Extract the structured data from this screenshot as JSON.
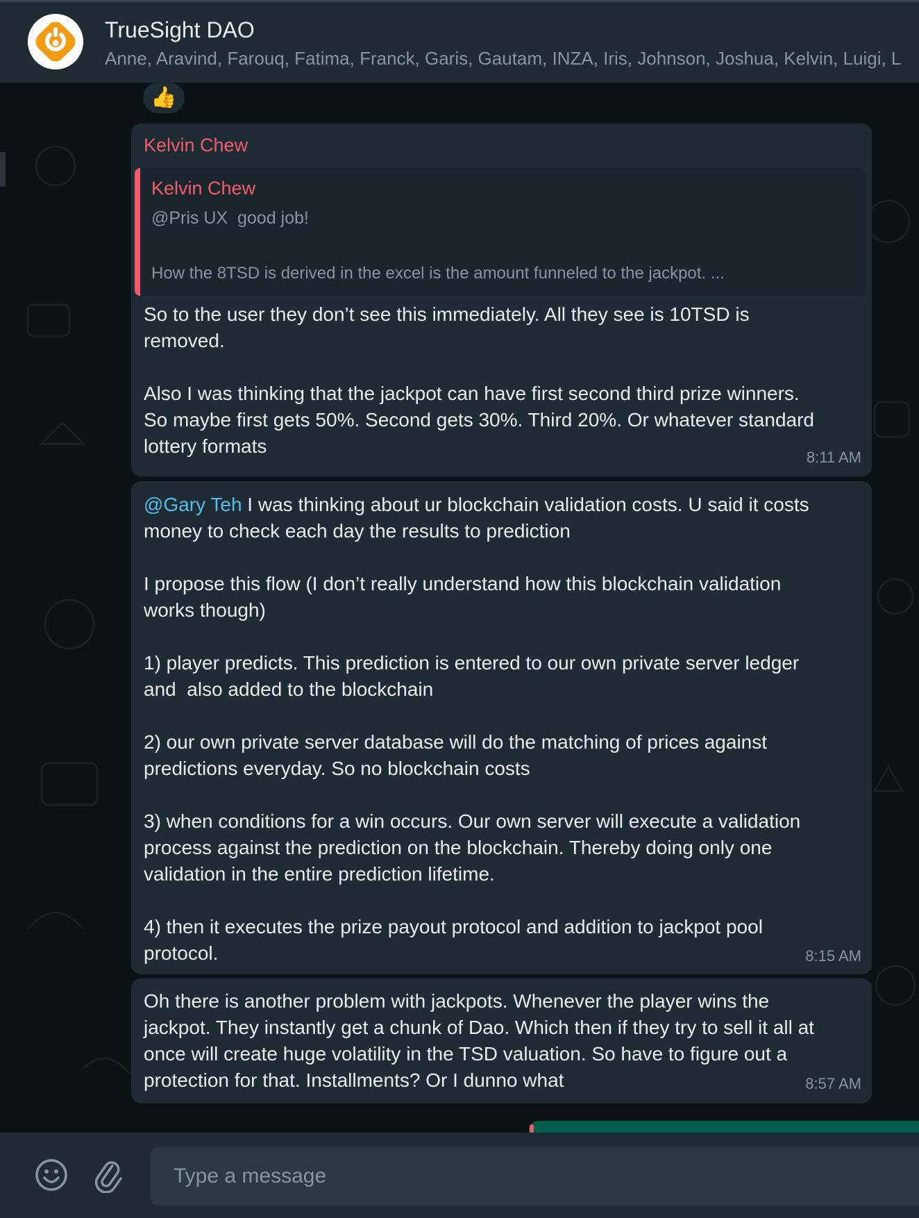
{
  "header": {
    "group_name": "TrueSight DAO",
    "members": "Anne, Aravind, Farouq, Fatima, Franck, Garis, Gautam, INZA, Iris, Johnson, Joshua, Kelvin, Luigi, L"
  },
  "reaction": {
    "emoji": "👍"
  },
  "messages": [
    {
      "sender": "Kelvin Chew",
      "quote": {
        "sender": "Kelvin Chew",
        "line1": "@Pris UX  good job!",
        "line2": "How the 8TSD is derived in the excel is the amount funneled to the jackpot. ..."
      },
      "text": "So to the user they don’t see this immediately. All they see is 10TSD is\nremoved.\n\nAlso I was thinking that the jackpot can have first second third prize winners.\nSo maybe first gets 50%. Second gets 30%. Third 20%. Or whatever standard\nlottery formats",
      "time": "8:11 AM"
    },
    {
      "mention": "@Gary Teh",
      "text": " I was thinking about ur blockchain validation costs. U said it costs\nmoney to check each day the results to prediction\n\nI propose this flow (I don’t really understand how this blockchain validation\nworks though)\n\n1) player predicts. This prediction is entered to our own private server ledger\nand  also added to the blockchain\n\n2) our own private server database will do the matching of prices against\npredictions everyday. So no blockchain costs\n\n3) when conditions for a win occurs. Our own server will execute a validation\nprocess against the prediction on the blockchain. Thereby doing only one\nvalidation in the entire prediction lifetime.\n\n4) then it executes the prize payout protocol and addition to jackpot pool\nprotocol.",
      "time": "8:15 AM"
    },
    {
      "text": "Oh there is another problem with jackpots. Whenever the player wins the\njackpot. They instantly get a chunk of Dao. Which then if they try to sell it all at\nonce will create huge volatility in the TSD valuation. So have to figure out a\nprotection for that. Installments? Or I dunno what",
      "time": "8:57 AM"
    }
  ],
  "composer": {
    "placeholder": "Type a message",
    "emoji_icon": "smiley-icon",
    "attach_icon": "paperclip-icon"
  }
}
